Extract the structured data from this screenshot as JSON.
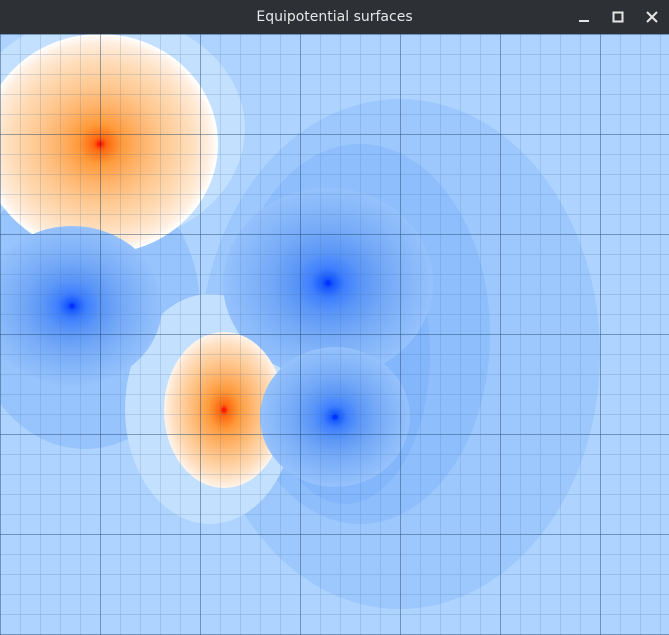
{
  "window": {
    "title": "Equipotential surfaces",
    "controls": {
      "minimize_icon": "minimize-icon",
      "maximize_icon": "maximize-icon",
      "close_icon": "close-icon"
    }
  },
  "field": {
    "charges": [
      {
        "sign": "positive",
        "strength": 1.0
      },
      {
        "sign": "negative",
        "strength": 0.55
      },
      {
        "sign": "negative",
        "strength": 0.55
      },
      {
        "sign": "positive",
        "strength": 0.6
      },
      {
        "sign": "negative",
        "strength": 0.5
      }
    ],
    "colors": {
      "positive_core": "#ff1a00",
      "positive_outer": "#ffe6cc",
      "negative_core": "#0033ff",
      "background": "#a8d0ff",
      "grid_minor": "#4a7fb5",
      "grid_major": "#1f4f80"
    },
    "grid": true
  }
}
